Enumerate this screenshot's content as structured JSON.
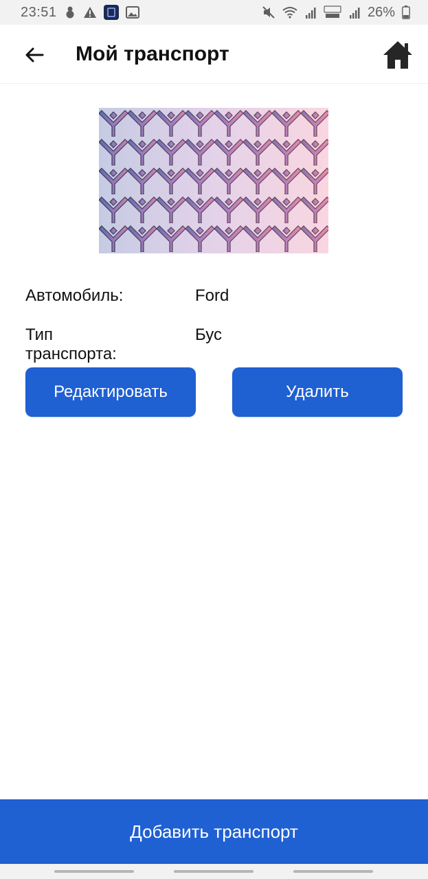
{
  "status_bar": {
    "time": "23:51",
    "battery_percent": "26%",
    "icons_left": [
      "snowman-icon",
      "warning-icon",
      "app-notification-icon",
      "image-icon"
    ],
    "icons_right": [
      "mute-icon",
      "wifi-icon",
      "signal-r-icon",
      "volte-lte2-icon",
      "signal-icon",
      "battery-icon"
    ]
  },
  "header": {
    "title": "Мой транспорт",
    "back_icon": "arrow-left-icon",
    "home_icon": "home-icon"
  },
  "vehicle": {
    "image_icon": "vehicle-image-pattern",
    "fields": [
      {
        "label": "Автомобиль:",
        "value": "Ford"
      },
      {
        "label": "Тип транспорта:",
        "value": "Бус"
      }
    ]
  },
  "actions": {
    "edit_label": "Редактировать",
    "delete_label": "Удалить"
  },
  "footer": {
    "add_label": "Добавить транспорт"
  },
  "colors": {
    "primary": "#1f60d2",
    "status_bar_bg": "#f2f2f2",
    "pattern_left": "#5a6bb0",
    "pattern_right": "#f08aa8"
  }
}
